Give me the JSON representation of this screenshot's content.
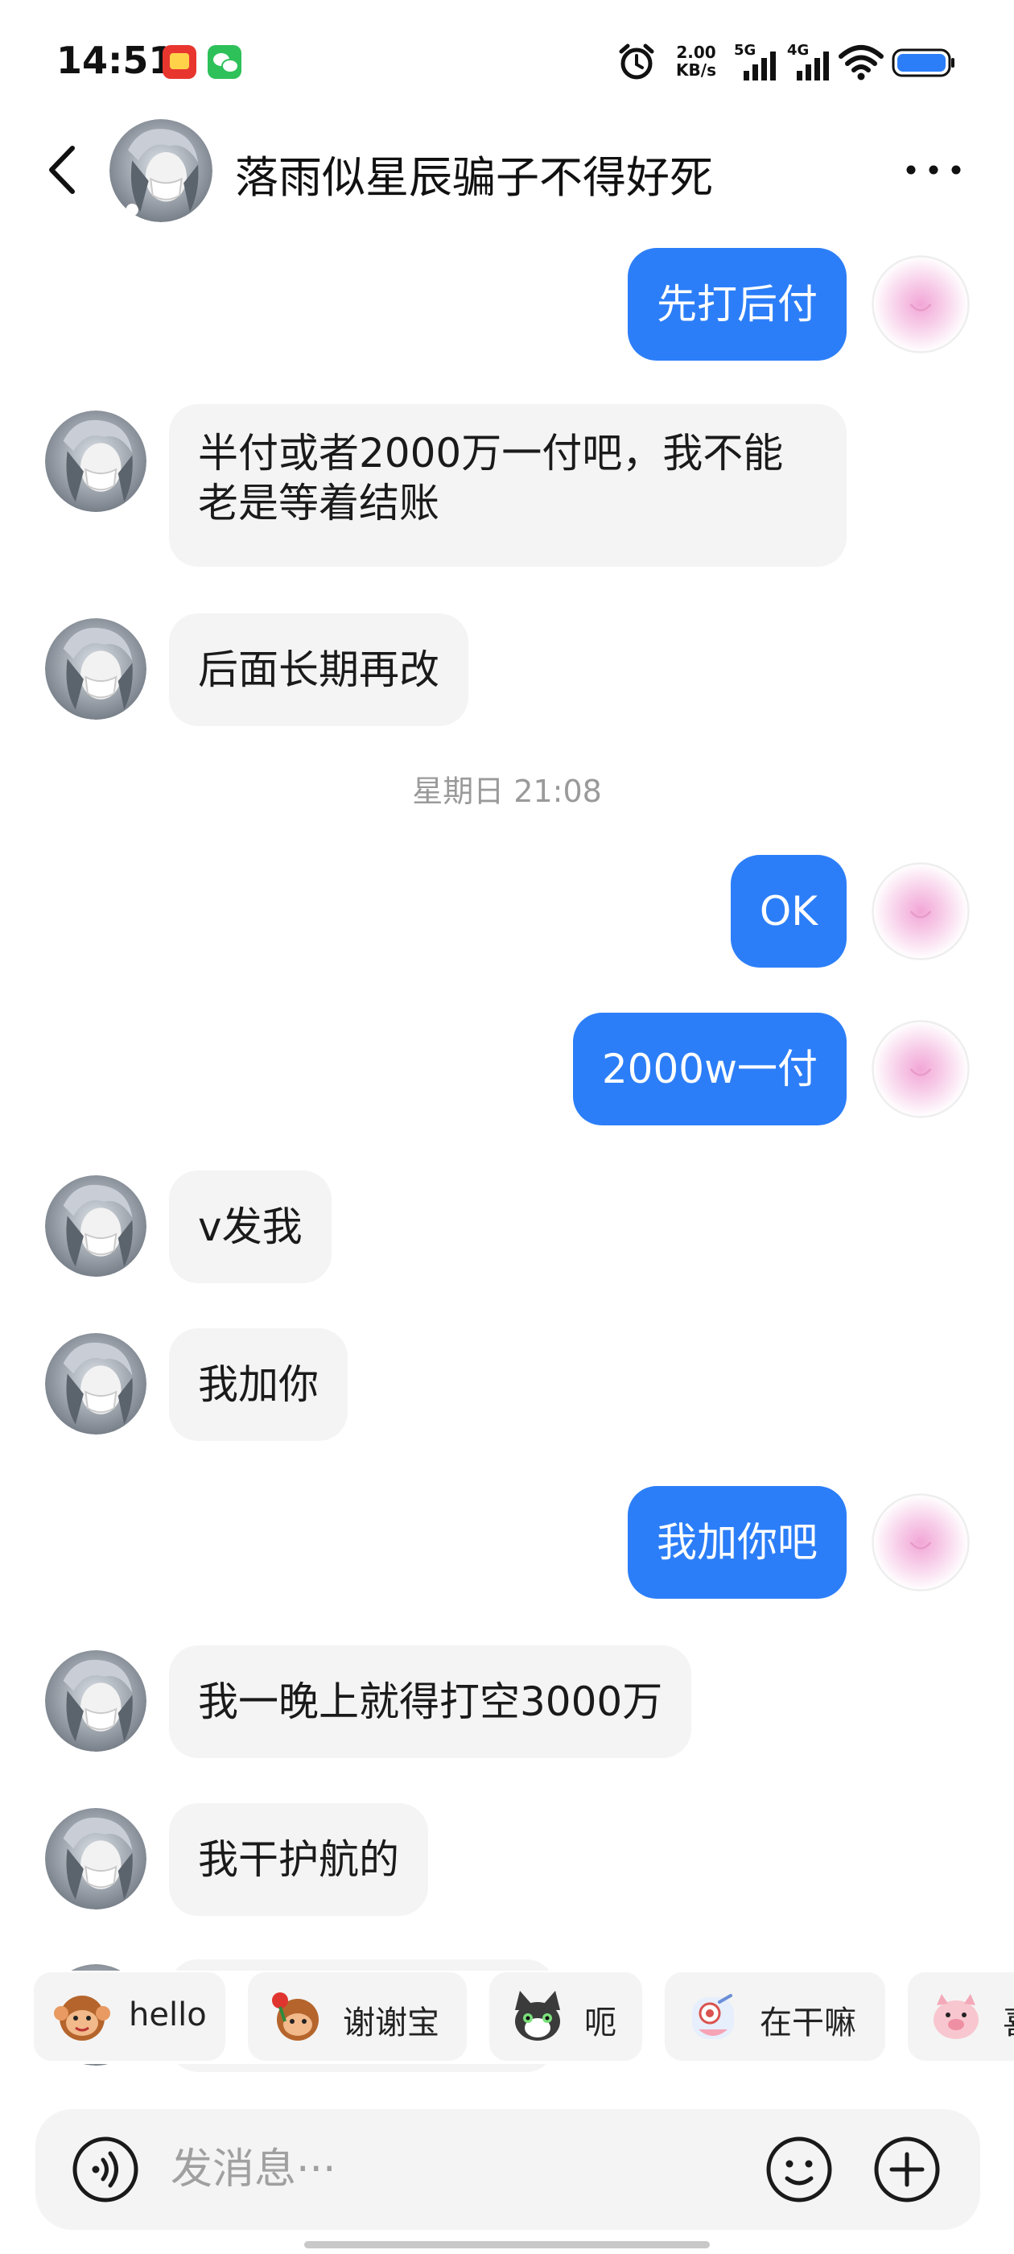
{
  "status_bar": {
    "time": "14:51",
    "net_speed_value": "2.00",
    "net_speed_unit": "KB/s",
    "signal_1": "5G",
    "signal_2": "4G",
    "battery_color": "#2c7ef8"
  },
  "header": {
    "title": "落雨似星辰骗子不得好死"
  },
  "messages": [
    {
      "side": "out",
      "text": "先打后付"
    },
    {
      "side": "in",
      "text": "半付或者2000万一付吧，我不能老是等着结账"
    },
    {
      "side": "in",
      "text": "后面长期再改"
    },
    {
      "side": "out",
      "text": "OK"
    },
    {
      "side": "out",
      "text": "2000w一付"
    },
    {
      "side": "in",
      "text": "v发我"
    },
    {
      "side": "in",
      "text": "我加你"
    },
    {
      "side": "out",
      "text": "我加你吧"
    },
    {
      "side": "in",
      "text": "我一晚上就得打空3000万"
    },
    {
      "side": "in",
      "text": "我干护航的"
    }
  ],
  "timestamp": "星期日 21:08",
  "quick_replies": [
    {
      "label": "hello",
      "icon": "monkey-emoji-icon"
    },
    {
      "label": "谢谢宝",
      "icon": "monkey-rose-emoji-icon"
    },
    {
      "label": "呃",
      "icon": "cat-emoji-icon"
    },
    {
      "label": "在干嘛",
      "icon": "peeking-emoji-icon"
    },
    {
      "label": "喜",
      "icon": "pig-emoji-icon"
    }
  ],
  "input": {
    "placeholder": "发消息···"
  },
  "colors": {
    "outgoing_bubble": "#2c7ef8",
    "incoming_bubble": "#f4f4f4"
  }
}
